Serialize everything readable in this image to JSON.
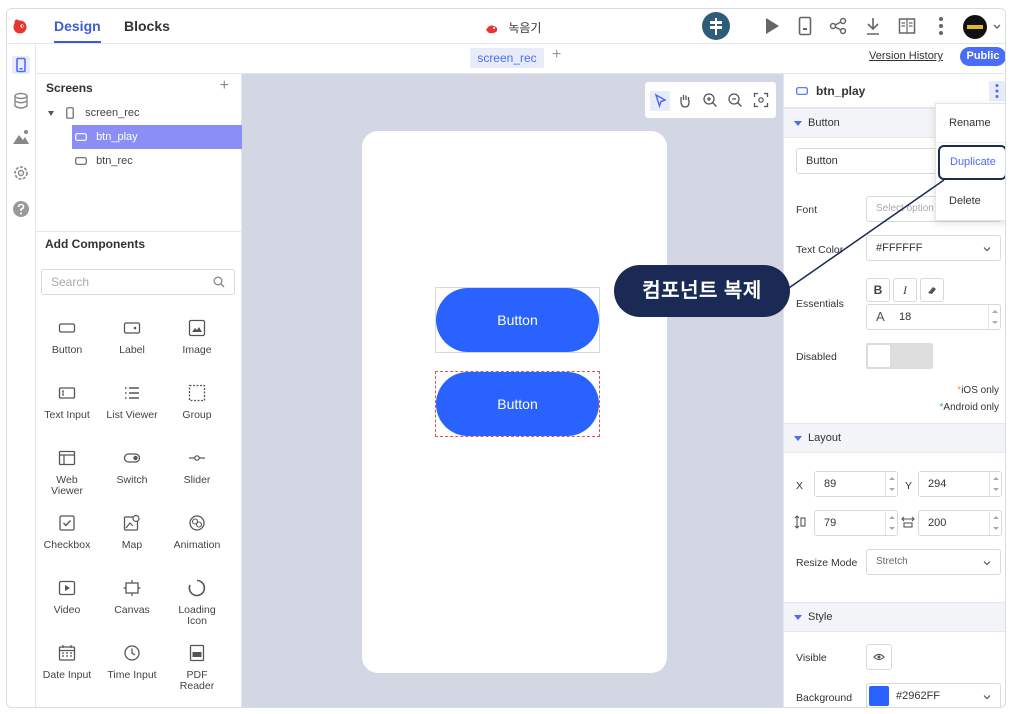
{
  "topbar": {
    "tabs": [
      "Design",
      "Blocks"
    ],
    "title": "녹음기",
    "icons": [
      "signpost-icon",
      "play-icon",
      "phone-icon",
      "share-icon",
      "download-icon",
      "book-icon",
      "more-vertical-icon",
      "avatar"
    ]
  },
  "subbar": {
    "screen_tab": "screen_rec",
    "add_label": "+",
    "version_history": "Version History",
    "public_label": "Public"
  },
  "leftnav": {
    "icons": [
      "phone-icon",
      "database-icon",
      "image-icon",
      "gear-icon",
      "help-icon"
    ]
  },
  "screens": {
    "header": "Screens",
    "add_label": "+",
    "tree": [
      {
        "label": "screen_rec",
        "level": 0,
        "selected": false
      },
      {
        "label": "btn_play",
        "level": 1,
        "selected": true
      },
      {
        "label": "btn_rec",
        "level": 1,
        "selected": false
      }
    ]
  },
  "components": {
    "header": "Add Components",
    "search_placeholder": "Search",
    "items": [
      {
        "label": "Button",
        "icon": "button-icon"
      },
      {
        "label": "Label",
        "icon": "label-icon"
      },
      {
        "label": "Image",
        "icon": "image-icon"
      },
      {
        "label": "Text Input",
        "icon": "text-input-icon"
      },
      {
        "label": "List Viewer",
        "icon": "list-icon"
      },
      {
        "label": "Group",
        "icon": "group-icon"
      },
      {
        "label": "Web\nViewer",
        "icon": "web-viewer-icon"
      },
      {
        "label": "Switch",
        "icon": "switch-icon"
      },
      {
        "label": "Slider",
        "icon": "slider-icon"
      },
      {
        "label": "Checkbox",
        "icon": "checkbox-icon"
      },
      {
        "label": "Map",
        "icon": "map-icon"
      },
      {
        "label": "Animation",
        "icon": "animation-icon"
      },
      {
        "label": "Video",
        "icon": "video-icon"
      },
      {
        "label": "Canvas",
        "icon": "canvas-icon"
      },
      {
        "label": "Loading\nIcon",
        "icon": "loading-icon"
      },
      {
        "label": "Date Input",
        "icon": "date-icon"
      },
      {
        "label": "Time Input",
        "icon": "clock-icon"
      },
      {
        "label": "PDF\nReader",
        "icon": "pdf-icon"
      }
    ]
  },
  "canvas": {
    "tools": [
      "pointer-icon",
      "hand-icon",
      "zoom-in-icon",
      "zoom-out-icon",
      "fit-screen-icon"
    ],
    "buttons": [
      "Button",
      "Button"
    ],
    "button_color": "#2962FF"
  },
  "properties": {
    "component_name": "btn_play",
    "sections": {
      "button": "Button",
      "layout": "Layout",
      "style": "Style"
    },
    "text_value": "Button",
    "font_label": "Font",
    "font_placeholder": "Select option",
    "text_color_label": "Text Color",
    "text_color_value": "#FFFFFF",
    "essentials_label": "Essentials",
    "bold_label": "B",
    "italic_label": "I",
    "font_size_label": "A",
    "font_size": "18",
    "disabled_label": "Disabled",
    "ios_note": "iOS only",
    "android_note": "Android only",
    "star": "*",
    "x_label": "X",
    "x_value": "89",
    "y_label": "Y",
    "y_value": "294",
    "height_value": "79",
    "width_value": "200",
    "resize_mode_label": "Resize Mode",
    "resize_mode_value": "Stretch",
    "visible_label": "Visible",
    "background_label": "Background",
    "background_value": "#2962FF"
  },
  "menu": {
    "items": [
      "Rename",
      "Duplicate",
      "Delete"
    ]
  },
  "callout": {
    "text": "컴포넌트 복제"
  }
}
